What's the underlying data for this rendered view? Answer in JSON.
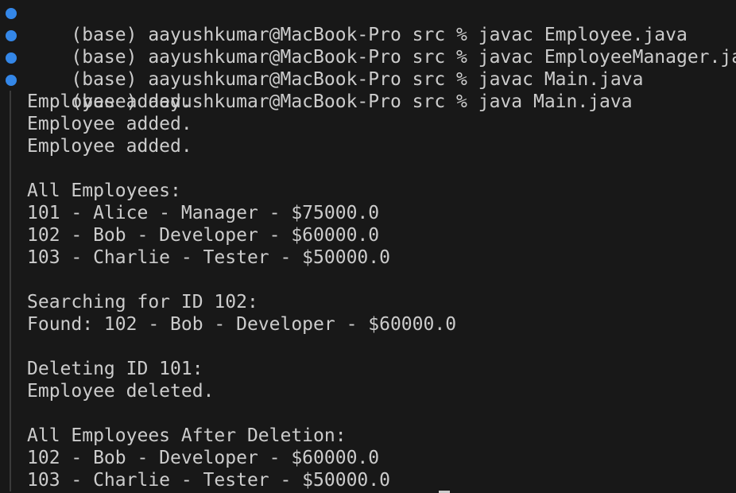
{
  "terminal": {
    "commands": [
      "(base) aayushkumar@MacBook-Pro src % javac Employee.java",
      "(base) aayushkumar@MacBook-Pro src % javac EmployeeManager.java",
      "(base) aayushkumar@MacBook-Pro src % javac Main.java",
      "(base) aayushkumar@MacBook-Pro src % java Main.java"
    ],
    "output": [
      "Employee added.",
      "Employee added.",
      "Employee added.",
      "",
      "All Employees:",
      "101 - Alice - Manager - $75000.0",
      "102 - Bob - Developer - $60000.0",
      "103 - Charlie - Tester - $50000.0",
      "",
      "Searching for ID 102:",
      "Found: 102 - Bob - Developer - $60000.0",
      "",
      "Deleting ID 101:",
      "Employee deleted.",
      "",
      "All Employees After Deletion:",
      "102 - Bob - Developer - $60000.0",
      "103 - Charlie - Tester - $50000.0"
    ],
    "colors": {
      "background": "#181818",
      "text": "#cccccc",
      "status_dot": "#3794ff"
    }
  }
}
